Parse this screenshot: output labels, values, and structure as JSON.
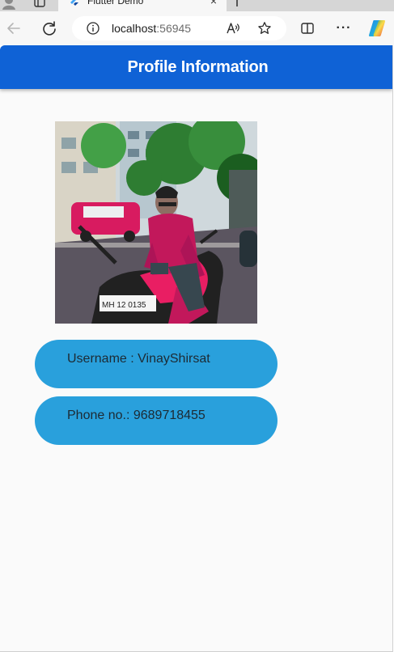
{
  "browser": {
    "tab": {
      "title": "Flutter Demo",
      "close_glyph": "×"
    },
    "address": {
      "host": "localhost",
      "port": ":56945"
    },
    "toolbar": {
      "more_glyph": "···"
    },
    "icons": {
      "profile": "profile-icon",
      "workspaces": "workspaces-icon",
      "favicon": "flutter-favicon-icon",
      "back": "back-arrow-icon",
      "reload": "reload-icon",
      "site_info": "info-icon",
      "read_aloud": "read-aloud-icon",
      "favorite": "star-icon",
      "split_screen": "split-screen-icon",
      "more": "more-icon",
      "copilot": "copilot-icon"
    }
  },
  "app": {
    "appbar_title": "Profile Information",
    "profile_photo": {
      "name": "profile-photo"
    },
    "username_label": "Username : VinayShirsat",
    "phone_label": "Phone no.: 9689718455",
    "colors": {
      "appbar": "#0f62d6",
      "pill": "#29a0dc",
      "background": "#fafafa"
    }
  }
}
